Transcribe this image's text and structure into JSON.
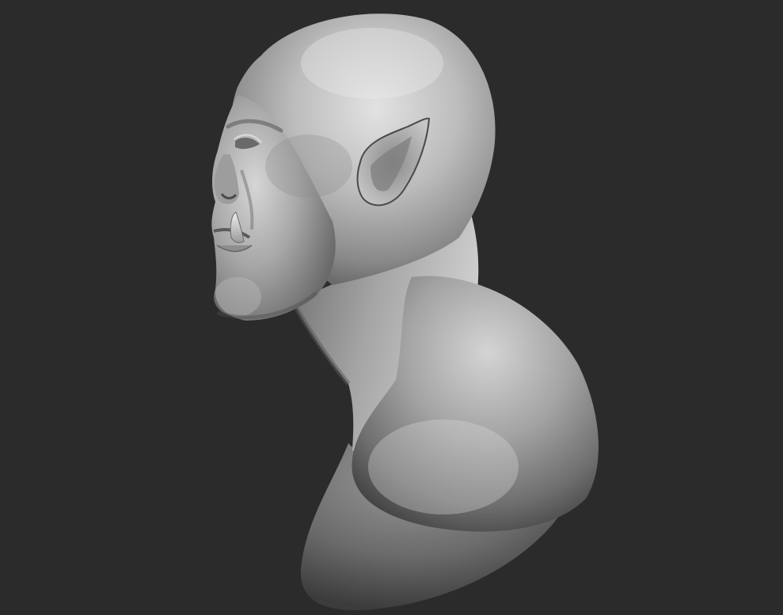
{
  "scene": {
    "subject": "orc-bust-sculpt",
    "background_color": "#2b2b2b",
    "material_color": "#9a9a9a",
    "highlight_color": "#e4e4e4",
    "shadow_color": "#3a3a3a"
  }
}
